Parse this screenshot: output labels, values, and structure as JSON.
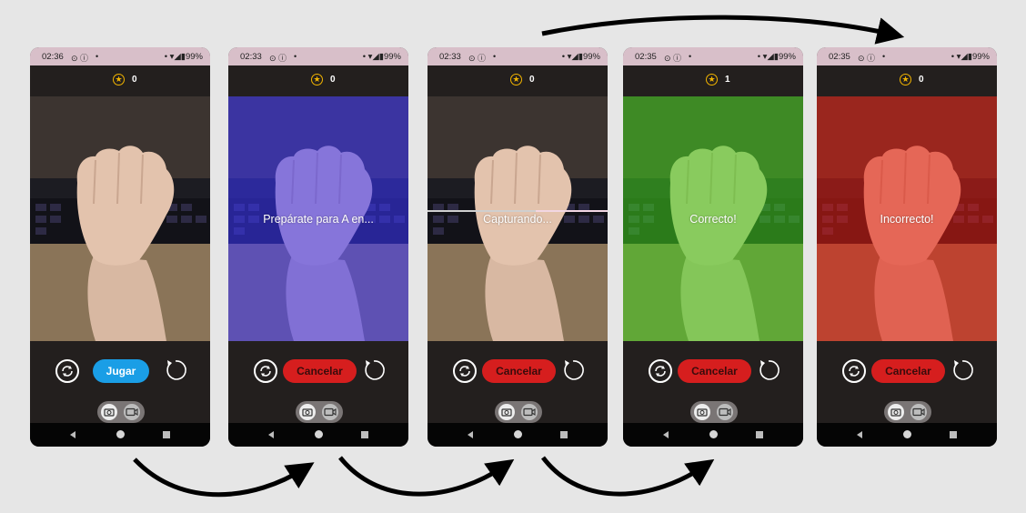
{
  "screens": [
    {
      "time": "02:36",
      "score": "0",
      "overlay": "",
      "button": "Jugar",
      "state": "ready",
      "tint": "#000000"
    },
    {
      "time": "02:33",
      "score": "0",
      "overlay": "Prepárate para A en...",
      "button": "Cancelar",
      "state": "countdown",
      "tint": "#3b34ff"
    },
    {
      "time": "02:33",
      "score": "0",
      "overlay": "Capturando...",
      "button": "Cancelar",
      "state": "capturing",
      "tint": "#000000",
      "progress": 0.6
    },
    {
      "time": "02:35",
      "score": "1",
      "overlay": "Correcto!",
      "button": "Cancelar",
      "state": "correct",
      "tint": "#3fd21d"
    },
    {
      "time": "02:35",
      "score": "0",
      "overlay": "Incorrecto!",
      "button": "Cancelar",
      "state": "incorrect",
      "tint": "#e81c10"
    }
  ],
  "status": {
    "dot": "•",
    "battery": "99%"
  },
  "icons": {
    "score": "star-circle-icon",
    "camera_switch": "rotate-camera-icon",
    "reset": "reset-icon",
    "photo_mode": "camera-icon",
    "video_mode": "video-icon",
    "nav_back": "back-icon",
    "nav_home": "home-icon",
    "nav_recent": "recent-apps-icon"
  }
}
